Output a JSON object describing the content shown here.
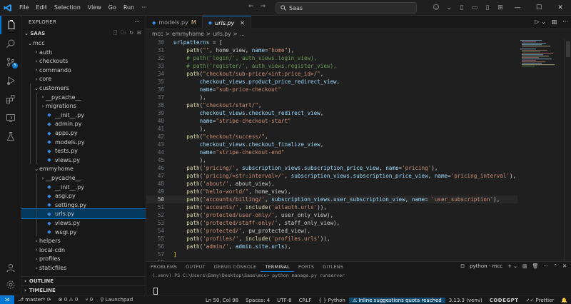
{
  "titlebar": {
    "menu": [
      "File",
      "Edit",
      "Selection",
      "View",
      "Go",
      "Run",
      "···"
    ],
    "search": "Saas"
  },
  "activity": {
    "source_control_badge": "5"
  },
  "explorer": {
    "header": "EXPLORER",
    "root": "SAAS",
    "tree": [
      {
        "label": "mcc",
        "type": "folder",
        "open": true,
        "depth": 0
      },
      {
        "label": "auth",
        "type": "folder",
        "open": false,
        "depth": 1
      },
      {
        "label": "checkouts",
        "type": "folder",
        "open": false,
        "depth": 1
      },
      {
        "label": "commando",
        "type": "folder",
        "open": false,
        "depth": 1
      },
      {
        "label": "core",
        "type": "folder",
        "open": false,
        "depth": 1
      },
      {
        "label": "customers",
        "type": "folder",
        "open": true,
        "depth": 1
      },
      {
        "label": "__pycache__",
        "type": "folder",
        "open": false,
        "depth": 2
      },
      {
        "label": "migrations",
        "type": "folder",
        "open": false,
        "depth": 2
      },
      {
        "label": "__init__.py",
        "type": "py",
        "depth": 2
      },
      {
        "label": "admin.py",
        "type": "py",
        "depth": 2
      },
      {
        "label": "apps.py",
        "type": "py",
        "depth": 2
      },
      {
        "label": "models.py",
        "type": "py",
        "depth": 2
      },
      {
        "label": "tests.py",
        "type": "py",
        "depth": 2
      },
      {
        "label": "views.py",
        "type": "py",
        "depth": 2
      },
      {
        "label": "emmyhome",
        "type": "folder",
        "open": true,
        "depth": 1
      },
      {
        "label": "__pycache__",
        "type": "folder",
        "open": false,
        "depth": 2
      },
      {
        "label": "__init__.py",
        "type": "py",
        "depth": 2
      },
      {
        "label": "asgi.py",
        "type": "py",
        "depth": 2
      },
      {
        "label": "settings.py",
        "type": "py",
        "depth": 2
      },
      {
        "label": "urls.py",
        "type": "py",
        "depth": 2,
        "selected": true
      },
      {
        "label": "views.py",
        "type": "py",
        "depth": 2
      },
      {
        "label": "wsgi.py",
        "type": "py",
        "depth": 2
      },
      {
        "label": "helpers",
        "type": "folder",
        "open": false,
        "depth": 1
      },
      {
        "label": "local-cdn",
        "type": "folder",
        "open": false,
        "depth": 1
      },
      {
        "label": "profiles",
        "type": "folder",
        "open": false,
        "depth": 1
      },
      {
        "label": "staticfiles",
        "type": "folder",
        "open": false,
        "depth": 1
      }
    ],
    "outline": "OUTLINE",
    "timeline": "TIMELINE"
  },
  "tabs": [
    {
      "label": "models.py",
      "modified": "M",
      "active": false
    },
    {
      "label": "urls.py",
      "modified": "",
      "active": true
    }
  ],
  "breadcrumb": [
    "mcc",
    ">",
    "emmyhome",
    ">",
    "urls.py",
    ">",
    "..."
  ],
  "editor": {
    "current_line": 50,
    "lines": [
      {
        "n": 30,
        "tokens": [
          [
            "urlpatterns",
            "var"
          ],
          [
            " = [",
            "p"
          ]
        ]
      },
      {
        "n": 31,
        "tokens": [
          [
            "    ",
            "p"
          ],
          [
            "path",
            "fn"
          ],
          [
            "(",
            "p"
          ],
          [
            "\"\"",
            "str"
          ],
          [
            ", home_view, ",
            "p"
          ],
          [
            "name",
            "var"
          ],
          [
            "=",
            "p"
          ],
          [
            "\"home\"",
            "str"
          ],
          [
            "),",
            "p"
          ]
        ]
      },
      {
        "n": 32,
        "tokens": [
          [
            "    ",
            "p"
          ],
          [
            "# path('login/', auth_views.login_view),",
            "cm"
          ]
        ]
      },
      {
        "n": 33,
        "tokens": [
          [
            "    ",
            "p"
          ],
          [
            "# path('register/', auth_views.register_view),",
            "cm"
          ]
        ]
      },
      {
        "n": 34,
        "tokens": [
          [
            "    ",
            "p"
          ],
          [
            "path",
            "fn"
          ],
          [
            "(",
            "p"
          ],
          [
            "\"checkout/sub-price/<int:price_id>/\"",
            "str"
          ],
          [
            ",",
            "p"
          ]
        ]
      },
      {
        "n": 35,
        "tokens": [
          [
            "        ",
            "p"
          ],
          [
            "checkout_views",
            "var"
          ],
          [
            ".",
            "p"
          ],
          [
            "product_price_redirect_view",
            "var"
          ],
          [
            ",",
            "p"
          ]
        ]
      },
      {
        "n": 36,
        "tokens": [
          [
            "        ",
            "p"
          ],
          [
            "name",
            "var"
          ],
          [
            "=",
            "p"
          ],
          [
            "\"sub-price-checkout\"",
            "str"
          ]
        ]
      },
      {
        "n": 37,
        "tokens": [
          [
            "        ",
            "p"
          ],
          [
            "),",
            "p"
          ]
        ]
      },
      {
        "n": 38,
        "tokens": [
          [
            "    ",
            "p"
          ],
          [
            "path",
            "fn"
          ],
          [
            "(",
            "p"
          ],
          [
            "\"checkout/start/\"",
            "str"
          ],
          [
            ",",
            "p"
          ]
        ]
      },
      {
        "n": 39,
        "tokens": [
          [
            "        ",
            "p"
          ],
          [
            "checkout_views",
            "var"
          ],
          [
            ".",
            "p"
          ],
          [
            "checkout_redirect_view",
            "var"
          ],
          [
            ",",
            "p"
          ]
        ]
      },
      {
        "n": 40,
        "tokens": [
          [
            "        ",
            "p"
          ],
          [
            "name",
            "var"
          ],
          [
            "=",
            "p"
          ],
          [
            "\"stripe-checkout-start\"",
            "str"
          ]
        ]
      },
      {
        "n": 41,
        "tokens": [
          [
            "        ",
            "p"
          ],
          [
            "),",
            "p"
          ]
        ]
      },
      {
        "n": 42,
        "tokens": [
          [
            "    ",
            "p"
          ],
          [
            "path",
            "fn"
          ],
          [
            "(",
            "p"
          ],
          [
            "\"checkout/success/\"",
            "str"
          ],
          [
            ",",
            "p"
          ]
        ]
      },
      {
        "n": 43,
        "tokens": [
          [
            "        ",
            "p"
          ],
          [
            "checkout_views",
            "var"
          ],
          [
            ".",
            "p"
          ],
          [
            "checkout_finalize_view",
            "var"
          ],
          [
            ",",
            "p"
          ]
        ]
      },
      {
        "n": 44,
        "tokens": [
          [
            "        ",
            "p"
          ],
          [
            "name",
            "var"
          ],
          [
            "=",
            "p"
          ],
          [
            "\"stripe-checkout-end\"",
            "str"
          ]
        ]
      },
      {
        "n": 45,
        "tokens": [
          [
            "        ",
            "p"
          ],
          [
            "),",
            "p"
          ]
        ]
      },
      {
        "n": 46,
        "tokens": [
          [
            "    ",
            "p"
          ],
          [
            "path",
            "fn"
          ],
          [
            "(",
            "p"
          ],
          [
            "'pricing/'",
            "str"
          ],
          [
            ", ",
            "p"
          ],
          [
            "subscription_views",
            "var"
          ],
          [
            ".",
            "p"
          ],
          [
            "subscription_price_view",
            "var"
          ],
          [
            ", ",
            "p"
          ],
          [
            "name",
            "var"
          ],
          [
            "=",
            "p"
          ],
          [
            "'pricing'",
            "str"
          ],
          [
            "),",
            "p"
          ]
        ]
      },
      {
        "n": 47,
        "tokens": [
          [
            "    ",
            "p"
          ],
          [
            "path",
            "fn"
          ],
          [
            "(",
            "p"
          ],
          [
            "'pricing/<str:interval>/'",
            "str"
          ],
          [
            ", ",
            "p"
          ],
          [
            "subscription_views",
            "var"
          ],
          [
            ".",
            "p"
          ],
          [
            "subscription_price_view",
            "var"
          ],
          [
            ", ",
            "p"
          ],
          [
            "name",
            "var"
          ],
          [
            "=",
            "p"
          ],
          [
            "'pricing_interval'",
            "str"
          ],
          [
            "),",
            "p"
          ]
        ]
      },
      {
        "n": 48,
        "tokens": [
          [
            "    ",
            "p"
          ],
          [
            "path",
            "fn"
          ],
          [
            "(",
            "p"
          ],
          [
            "'about/'",
            "str"
          ],
          [
            ", about_view),",
            "p"
          ]
        ]
      },
      {
        "n": 49,
        "tokens": [
          [
            "    ",
            "p"
          ],
          [
            "path",
            "fn"
          ],
          [
            "(",
            "p"
          ],
          [
            "\"hello-world/\"",
            "str"
          ],
          [
            ", home_view),",
            "p"
          ]
        ]
      },
      {
        "n": 50,
        "tokens": [
          [
            "    ",
            "p"
          ],
          [
            "path",
            "fn"
          ],
          [
            "(",
            "p"
          ],
          [
            "'accounts/billing/'",
            "str"
          ],
          [
            ", ",
            "p"
          ],
          [
            "subscription_views",
            "var"
          ],
          [
            ".",
            "p"
          ],
          [
            "user_subscription_view",
            "var"
          ],
          [
            ", ",
            "p"
          ],
          [
            "name",
            "var"
          ],
          [
            "= ",
            "p"
          ],
          [
            "'user_subscription'",
            "str"
          ],
          [
            "),",
            "p"
          ]
        ]
      },
      {
        "n": 51,
        "tokens": [
          [
            "    ",
            "p"
          ],
          [
            "path",
            "fn"
          ],
          [
            "(",
            "p"
          ],
          [
            "'accounts/'",
            "str"
          ],
          [
            ", ",
            "p"
          ],
          [
            "include",
            "fn"
          ],
          [
            "(",
            "p"
          ],
          [
            "'allauth.urls'",
            "str"
          ],
          [
            ")),",
            "p"
          ]
        ]
      },
      {
        "n": 52,
        "tokens": [
          [
            "    ",
            "p"
          ],
          [
            "path",
            "fn"
          ],
          [
            "(",
            "p"
          ],
          [
            "'protected/user-only/'",
            "str"
          ],
          [
            ", user_only_view),",
            "p"
          ]
        ]
      },
      {
        "n": 53,
        "tokens": [
          [
            "    ",
            "p"
          ],
          [
            "path",
            "fn"
          ],
          [
            "(",
            "p"
          ],
          [
            "'protected/staff-only/'",
            "str"
          ],
          [
            ", staff_only_view),",
            "p"
          ]
        ]
      },
      {
        "n": 54,
        "tokens": [
          [
            "    ",
            "p"
          ],
          [
            "path",
            "fn"
          ],
          [
            "(",
            "p"
          ],
          [
            "'protected/'",
            "str"
          ],
          [
            ", pw_protected_view),",
            "p"
          ]
        ]
      },
      {
        "n": 55,
        "tokens": [
          [
            "    ",
            "p"
          ],
          [
            "path",
            "fn"
          ],
          [
            "(",
            "p"
          ],
          [
            "'profiles/'",
            "str"
          ],
          [
            ", ",
            "p"
          ],
          [
            "include",
            "fn"
          ],
          [
            "(",
            "p"
          ],
          [
            "'profiles.urls'",
            "str"
          ],
          [
            ")),",
            "p"
          ]
        ]
      },
      {
        "n": 56,
        "tokens": [
          [
            "    ",
            "p"
          ],
          [
            "path",
            "fn"
          ],
          [
            "(",
            "p"
          ],
          [
            "'admin/'",
            "str"
          ],
          [
            ", ",
            "p"
          ],
          [
            "admin",
            "var"
          ],
          [
            ".",
            "p"
          ],
          [
            "site",
            "var"
          ],
          [
            ".",
            "p"
          ],
          [
            "urls",
            "var"
          ],
          [
            "),",
            "p"
          ]
        ]
      },
      {
        "n": 57,
        "tokens": [
          [
            "]",
            "kw"
          ]
        ]
      },
      {
        "n": 58,
        "tokens": []
      }
    ]
  },
  "panel": {
    "tabs": [
      "PROBLEMS",
      "OUTPUT",
      "DEBUG CONSOLE",
      "TERMINAL",
      "PORTS",
      "GITLENS"
    ],
    "active_tab": "TERMINAL",
    "terminal_name": "python - mcc",
    "terminal_text": "(.venv) PS C:\\Users\\Emmy\\Desktop\\Saas\\mcc> python manage.py runserver"
  },
  "statusbar": {
    "branch": "master*",
    "sync": "⟳",
    "errors": "0",
    "warnings": "0",
    "ports": "0",
    "launchpad": "Launchpad",
    "position": "Ln 50, Col 98",
    "spaces": "Spaces: 4",
    "encoding": "UTF-8",
    "eol": "CRLF",
    "language": "Python",
    "copilot": "Inline suggestions quota reached",
    "interpreter": "3.13.3 (venv)",
    "codegpt": "CODEGPT",
    "prettier": "Prettier"
  },
  "colors": {
    "accent": "#0078d4",
    "selection": "#04395e",
    "string": "#ce9178",
    "function": "#dcdcaa",
    "variable": "#9cdcfe",
    "comment": "#6a9955"
  }
}
